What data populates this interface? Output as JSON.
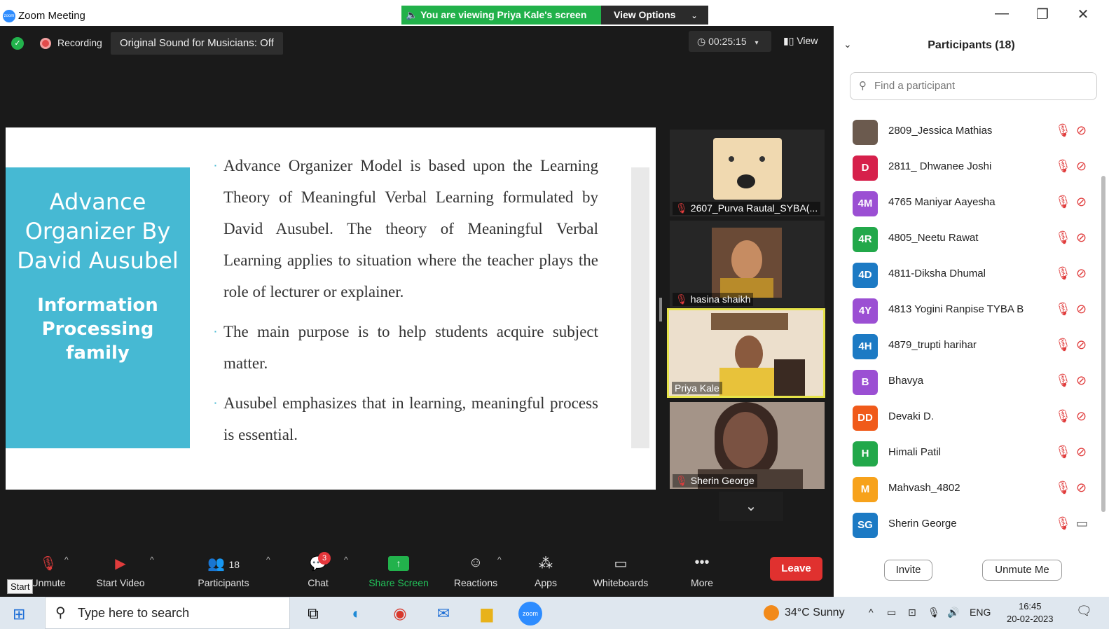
{
  "window": {
    "title": "Zoom Meeting",
    "viewing_banner": "You are viewing Priya Kale's screen",
    "view_options": "View Options",
    "controls": {
      "minimize": "—",
      "restore": "❐",
      "close": "✕"
    }
  },
  "meeting": {
    "recording_label": "Recording",
    "original_sound": "Original Sound for Musicians: Off",
    "timer": "00:25:15",
    "view_label": "View"
  },
  "slide": {
    "title": "Advance Organizer By David Ausubel",
    "subtitle": "Information Processing family",
    "bullets": [
      "Advance Organizer Model is based upon the Learning Theory of Meaningful Verbal Learning formulated by David  Ausubel. The theory of Meaningful Verbal Learning applies to situation where the teacher plays the role of lecturer or explainer.",
      "The main purpose is to help students acquire subject matter.",
      "Ausubel emphasizes that in learning, meaningful process is essential."
    ]
  },
  "video_thumbnails": [
    {
      "name": "2607_Purva Rautal_SYBA(...",
      "muted": true,
      "bg": "#3a3a3a",
      "face": "#d9a86a"
    },
    {
      "name": "hasina shaikh",
      "muted": true,
      "bg": "#2e2e2e",
      "face": "#8c5a3a"
    },
    {
      "name": "Priya Kale",
      "muted": false,
      "bg": "#e9dccb",
      "face": "#7b4a33"
    },
    {
      "name": "Sherin George",
      "muted": true,
      "bg": "#9e8f86",
      "face": "#4a3a33"
    }
  ],
  "toolbar": {
    "unmute_label": "Unmute",
    "start_video_label": "Start Video",
    "participants_label": "Participants",
    "participants_count": "18",
    "chat_label": "Chat",
    "chat_badge": "3",
    "share_screen_label": "Share Screen",
    "reactions_label": "Reactions",
    "apps_label": "Apps",
    "whiteboards_label": "Whiteboards",
    "more_label": "More",
    "leave_label": "Leave",
    "tooltip": "Start"
  },
  "panel": {
    "title": "Participants (18)",
    "search_placeholder": "Find a participant",
    "participants": [
      {
        "initials": "",
        "name": "2809_Jessica Mathias",
        "color": "#6b5a4e",
        "cam_on": false
      },
      {
        "initials": "D",
        "name": "2811_ Dhwanee Joshi",
        "color": "#d6204b",
        "cam_on": false
      },
      {
        "initials": "4M",
        "name": "4765 Maniyar Aayesha",
        "color": "#9b4fd3",
        "cam_on": false
      },
      {
        "initials": "4R",
        "name": "4805_Neetu Rawat",
        "color": "#22a84a",
        "cam_on": false
      },
      {
        "initials": "4D",
        "name": "4811-Diksha Dhumal",
        "color": "#1c7ac4",
        "cam_on": false
      },
      {
        "initials": "4Y",
        "name": "4813 Yogini Ranpise TYBA B",
        "color": "#9b4fd3",
        "cam_on": false
      },
      {
        "initials": "4H",
        "name": "4879_trupti harihar",
        "color": "#1c7ac4",
        "cam_on": false
      },
      {
        "initials": "B",
        "name": "Bhavya",
        "color": "#9b4fd3",
        "cam_on": false
      },
      {
        "initials": "DD",
        "name": "Devaki D.",
        "color": "#f05a1a",
        "cam_on": false
      },
      {
        "initials": "H",
        "name": "Himali Patil",
        "color": "#22a84a",
        "cam_on": false
      },
      {
        "initials": "M",
        "name": "Mahvash_4802",
        "color": "#f7a21b",
        "cam_on": false
      },
      {
        "initials": "SG",
        "name": "Sherin George",
        "color": "#1c7ac4",
        "cam_on": true
      }
    ],
    "invite_label": "Invite",
    "unmute_me_label": "Unmute Me"
  },
  "taskbar": {
    "search_placeholder": "Type here to search",
    "weather": "34°C  Sunny",
    "language": "ENG",
    "time": "16:45",
    "date": "20-02-2023"
  }
}
